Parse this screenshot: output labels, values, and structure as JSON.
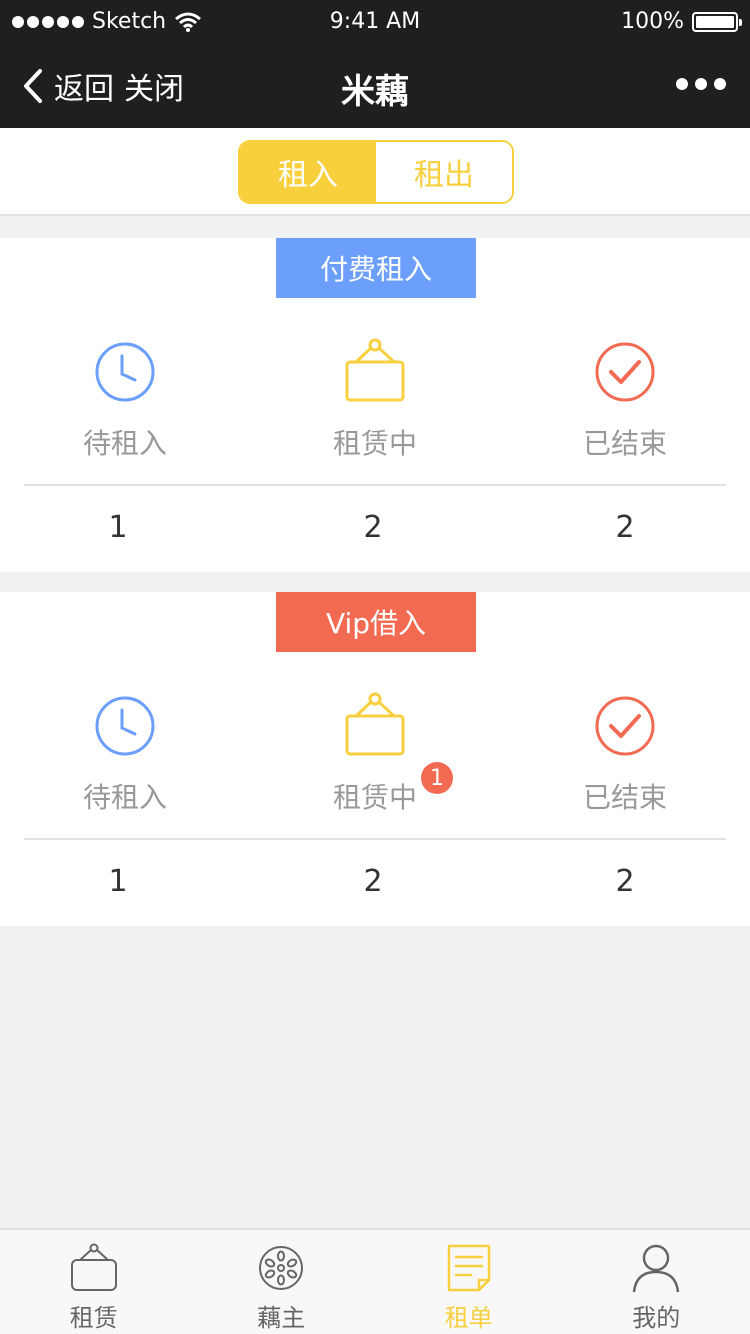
{
  "status": {
    "carrier": "Sketch",
    "time": "9:41 AM",
    "battery": "100%"
  },
  "nav": {
    "back_label": "返回",
    "close_label": "关闭",
    "title": "米藕"
  },
  "switch": {
    "rent_in": "租入",
    "rent_out": "租出"
  },
  "colors": {
    "accent": "#f8cf3d",
    "blue": "#6b9ffb",
    "red": "#f26a52"
  },
  "sections": [
    {
      "tag": "付费租入",
      "columns": [
        {
          "label": "待租入",
          "count": "1",
          "icon": "clock-icon"
        },
        {
          "label": "租赁中",
          "count": "2",
          "icon": "hanging-sign-icon"
        },
        {
          "label": "已结束",
          "count": "2",
          "icon": "check-circle-icon"
        }
      ]
    },
    {
      "tag": "Vip借入",
      "columns": [
        {
          "label": "待租入",
          "count": "1",
          "icon": "clock-icon"
        },
        {
          "label": "租赁中",
          "count": "2",
          "icon": "hanging-sign-icon",
          "badge": "1"
        },
        {
          "label": "已结束",
          "count": "2",
          "icon": "check-circle-icon"
        }
      ]
    }
  ],
  "tabs": [
    {
      "label": "租赁",
      "icon": "hanging-sign-icon"
    },
    {
      "label": "藕主",
      "icon": "lotus-root-icon"
    },
    {
      "label": "租单",
      "icon": "order-list-icon"
    },
    {
      "label": "我的",
      "icon": "user-icon"
    }
  ]
}
